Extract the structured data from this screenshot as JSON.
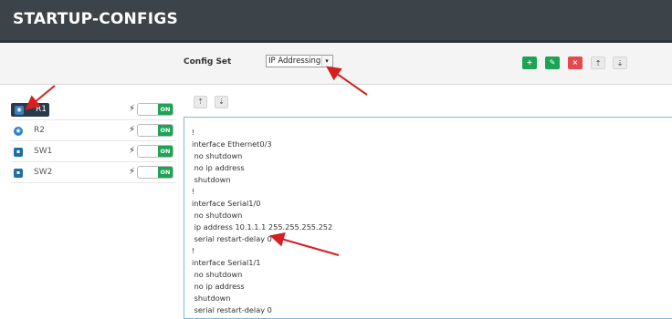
{
  "header": {
    "title": "STARTUP-CONFIGS"
  },
  "toolbar": {
    "config_set_label": "Config Set",
    "config_set_value": "IP Addressing",
    "add_glyph": "+",
    "edit_glyph": "✎",
    "delete_glyph": "×",
    "upload_glyph": "⇡",
    "download_glyph": "⇣"
  },
  "nodes": [
    {
      "name": "R1",
      "state": "ON",
      "selected": true,
      "icon": "router-icon"
    },
    {
      "name": "R2",
      "state": "ON",
      "selected": false,
      "icon": "router-icon"
    },
    {
      "name": "SW1",
      "state": "ON",
      "selected": false,
      "icon": "switch-icon"
    },
    {
      "name": "SW2",
      "state": "ON",
      "selected": false,
      "icon": "switch-icon"
    }
  ],
  "editor_toolbar": {
    "upload_glyph": "⇡",
    "download_glyph": "⇣"
  },
  "config_lines": [
    "!",
    "interface Ethernet0/3",
    " no shutdown",
    " no ip address",
    " shutdown",
    "!",
    "interface Serial1/0",
    " no shutdown",
    " ip address 10.1.1.1 255.255.255.252",
    " serial restart-delay 0",
    "!",
    "interface Serial1/1",
    " no shutdown",
    " no ip address",
    " shutdown",
    " serial restart-delay 0"
  ],
  "colors": {
    "accent_green": "#1ca354",
    "danger_red": "#e5484d",
    "header_bg": "#3c4449",
    "annotation_arrow": "#d42020"
  }
}
